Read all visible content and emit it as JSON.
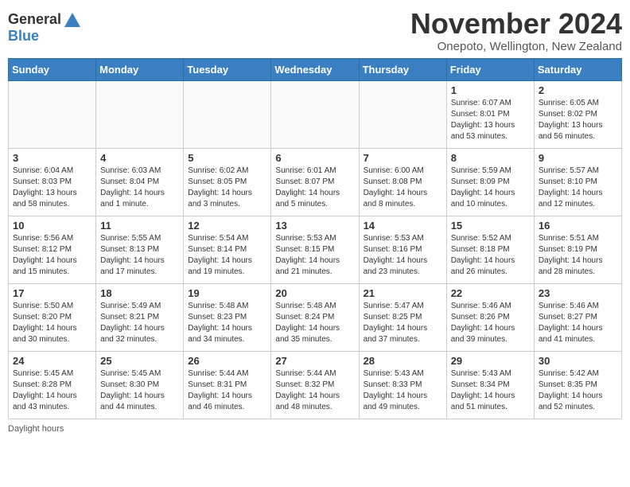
{
  "header": {
    "logo_general": "General",
    "logo_blue": "Blue",
    "month_title": "November 2024",
    "location": "Onepoto, Wellington, New Zealand"
  },
  "weekdays": [
    "Sunday",
    "Monday",
    "Tuesday",
    "Wednesday",
    "Thursday",
    "Friday",
    "Saturday"
  ],
  "footer": {
    "daylight_hours": "Daylight hours"
  },
  "weeks": [
    [
      {
        "day": "",
        "info": ""
      },
      {
        "day": "",
        "info": ""
      },
      {
        "day": "",
        "info": ""
      },
      {
        "day": "",
        "info": ""
      },
      {
        "day": "",
        "info": ""
      },
      {
        "day": "1",
        "info": "Sunrise: 6:07 AM\nSunset: 8:01 PM\nDaylight: 13 hours\nand 53 minutes."
      },
      {
        "day": "2",
        "info": "Sunrise: 6:05 AM\nSunset: 8:02 PM\nDaylight: 13 hours\nand 56 minutes."
      }
    ],
    [
      {
        "day": "3",
        "info": "Sunrise: 6:04 AM\nSunset: 8:03 PM\nDaylight: 13 hours\nand 58 minutes."
      },
      {
        "day": "4",
        "info": "Sunrise: 6:03 AM\nSunset: 8:04 PM\nDaylight: 14 hours\nand 1 minute."
      },
      {
        "day": "5",
        "info": "Sunrise: 6:02 AM\nSunset: 8:05 PM\nDaylight: 14 hours\nand 3 minutes."
      },
      {
        "day": "6",
        "info": "Sunrise: 6:01 AM\nSunset: 8:07 PM\nDaylight: 14 hours\nand 5 minutes."
      },
      {
        "day": "7",
        "info": "Sunrise: 6:00 AM\nSunset: 8:08 PM\nDaylight: 14 hours\nand 8 minutes."
      },
      {
        "day": "8",
        "info": "Sunrise: 5:59 AM\nSunset: 8:09 PM\nDaylight: 14 hours\nand 10 minutes."
      },
      {
        "day": "9",
        "info": "Sunrise: 5:57 AM\nSunset: 8:10 PM\nDaylight: 14 hours\nand 12 minutes."
      }
    ],
    [
      {
        "day": "10",
        "info": "Sunrise: 5:56 AM\nSunset: 8:12 PM\nDaylight: 14 hours\nand 15 minutes."
      },
      {
        "day": "11",
        "info": "Sunrise: 5:55 AM\nSunset: 8:13 PM\nDaylight: 14 hours\nand 17 minutes."
      },
      {
        "day": "12",
        "info": "Sunrise: 5:54 AM\nSunset: 8:14 PM\nDaylight: 14 hours\nand 19 minutes."
      },
      {
        "day": "13",
        "info": "Sunrise: 5:53 AM\nSunset: 8:15 PM\nDaylight: 14 hours\nand 21 minutes."
      },
      {
        "day": "14",
        "info": "Sunrise: 5:53 AM\nSunset: 8:16 PM\nDaylight: 14 hours\nand 23 minutes."
      },
      {
        "day": "15",
        "info": "Sunrise: 5:52 AM\nSunset: 8:18 PM\nDaylight: 14 hours\nand 26 minutes."
      },
      {
        "day": "16",
        "info": "Sunrise: 5:51 AM\nSunset: 8:19 PM\nDaylight: 14 hours\nand 28 minutes."
      }
    ],
    [
      {
        "day": "17",
        "info": "Sunrise: 5:50 AM\nSunset: 8:20 PM\nDaylight: 14 hours\nand 30 minutes."
      },
      {
        "day": "18",
        "info": "Sunrise: 5:49 AM\nSunset: 8:21 PM\nDaylight: 14 hours\nand 32 minutes."
      },
      {
        "day": "19",
        "info": "Sunrise: 5:48 AM\nSunset: 8:23 PM\nDaylight: 14 hours\nand 34 minutes."
      },
      {
        "day": "20",
        "info": "Sunrise: 5:48 AM\nSunset: 8:24 PM\nDaylight: 14 hours\nand 35 minutes."
      },
      {
        "day": "21",
        "info": "Sunrise: 5:47 AM\nSunset: 8:25 PM\nDaylight: 14 hours\nand 37 minutes."
      },
      {
        "day": "22",
        "info": "Sunrise: 5:46 AM\nSunset: 8:26 PM\nDaylight: 14 hours\nand 39 minutes."
      },
      {
        "day": "23",
        "info": "Sunrise: 5:46 AM\nSunset: 8:27 PM\nDaylight: 14 hours\nand 41 minutes."
      }
    ],
    [
      {
        "day": "24",
        "info": "Sunrise: 5:45 AM\nSunset: 8:28 PM\nDaylight: 14 hours\nand 43 minutes."
      },
      {
        "day": "25",
        "info": "Sunrise: 5:45 AM\nSunset: 8:30 PM\nDaylight: 14 hours\nand 44 minutes."
      },
      {
        "day": "26",
        "info": "Sunrise: 5:44 AM\nSunset: 8:31 PM\nDaylight: 14 hours\nand 46 minutes."
      },
      {
        "day": "27",
        "info": "Sunrise: 5:44 AM\nSunset: 8:32 PM\nDaylight: 14 hours\nand 48 minutes."
      },
      {
        "day": "28",
        "info": "Sunrise: 5:43 AM\nSunset: 8:33 PM\nDaylight: 14 hours\nand 49 minutes."
      },
      {
        "day": "29",
        "info": "Sunrise: 5:43 AM\nSunset: 8:34 PM\nDaylight: 14 hours\nand 51 minutes."
      },
      {
        "day": "30",
        "info": "Sunrise: 5:42 AM\nSunset: 8:35 PM\nDaylight: 14 hours\nand 52 minutes."
      }
    ]
  ]
}
